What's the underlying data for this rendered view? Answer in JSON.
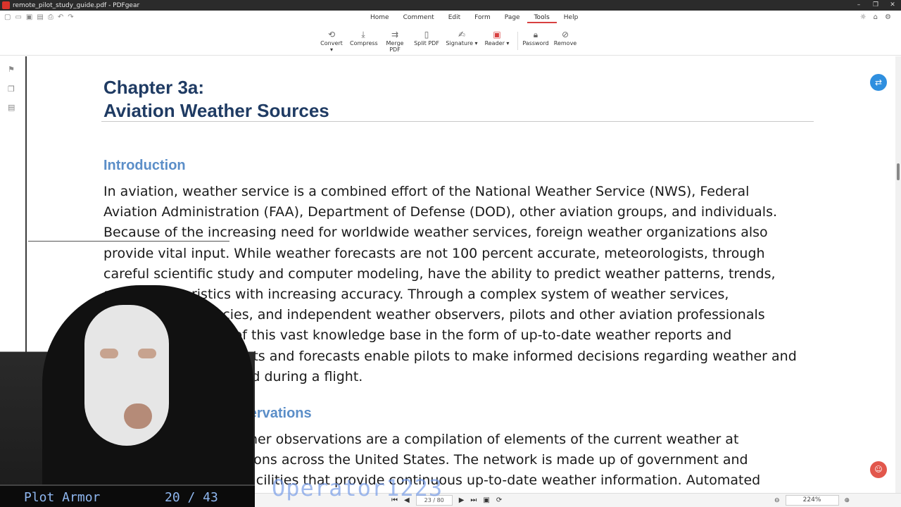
{
  "window": {
    "title": "remote_pilot_study_guide.pdf - PDFgear",
    "controls": [
      "–",
      "❐",
      "✕"
    ]
  },
  "menu": {
    "tabs": [
      "Home",
      "Comment",
      "Edit",
      "Form",
      "Page",
      "Tools",
      "Help"
    ],
    "active_tab": "Tools"
  },
  "toolbar": {
    "tools": [
      {
        "label": "Convert ▾",
        "icon": "convert-icon"
      },
      {
        "label": "Compress",
        "icon": "compress-icon"
      },
      {
        "label": "Merge PDF",
        "icon": "merge-icon"
      },
      {
        "label": "Split PDF",
        "icon": "split-icon"
      },
      {
        "label": "Signature ▾",
        "icon": "signature-icon"
      },
      {
        "label": "Reader ▾",
        "icon": "reader-icon"
      },
      {
        "label": "Password",
        "icon": "lock-icon"
      },
      {
        "label": "Remove",
        "icon": "remove-icon"
      }
    ]
  },
  "document": {
    "chapter_line1": "Chapter 3a:",
    "chapter_line2": "Aviation Weather Sources",
    "intro_heading": "Introduction",
    "intro_lines": [
      "In aviation, weather service is a combined effort of the National Weather Service (NWS), Federal",
      "Aviation Administration (FAA), Department of Defense (DOD), other aviation groups, and individuals.",
      "Because of the increasing need for worldwide weather services, foreign weather organizations also",
      "provide vital input. While weather forecasts are not 100 percent accurate, meteorologists, through",
      "careful scientific study and computer modeling, have the ability to predict weather patterns, trends,",
      "and characteristics with increasing accuracy. Through a complex system of weather services,",
      "government agencies, and independent weather observers, pilots and other aviation professionals",
      "receive the benefit of this vast knowledge base in the form of up-to-date weather reports and",
      "forecasts. These reports and forecasts enable pilots to make informed decisions regarding weather and",
      "flight safety before and during a flight."
    ],
    "obs_heading": "Aviation Weather Observations",
    "obs_lines": [
      "Surface aviation weather observations are a compilation of elements of the current weather at",
      "individual ground stations across the United States. The network is made up of government and",
      "privately contracted facilities that provide continuous up-to-date weather information. Automated"
    ]
  },
  "status": {
    "page_display": "23 / 80",
    "zoom": "224%"
  },
  "overlay": {
    "plot_name": "Plot Armor",
    "plot_count": "20 / 43",
    "operator": "Operator1223"
  }
}
